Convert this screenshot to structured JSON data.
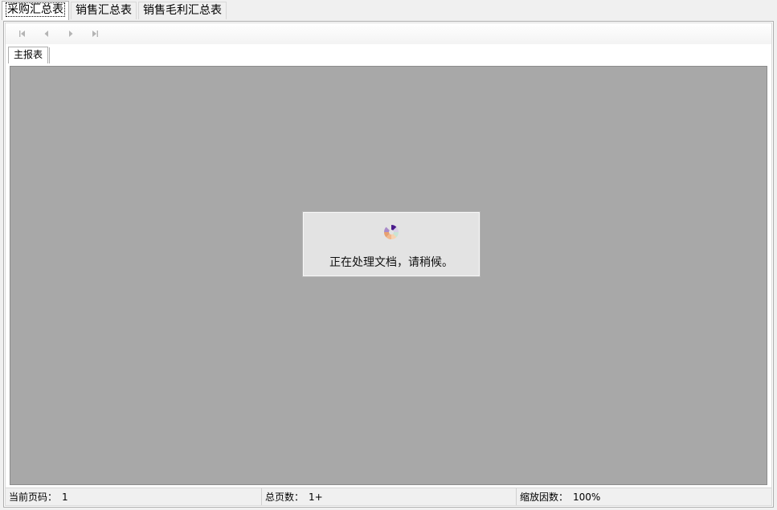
{
  "top_tabs": [
    {
      "label": "采购汇总表",
      "active": true
    },
    {
      "label": "销售汇总表",
      "active": false
    },
    {
      "label": "销售毛利汇总表",
      "active": false
    }
  ],
  "navigation": {
    "buttons": [
      "first-page-icon",
      "previous-page-icon",
      "next-page-icon",
      "last-page-icon"
    ]
  },
  "report_tabs": [
    {
      "label": "主报表",
      "active": true
    }
  ],
  "loading": {
    "message": "正在处理文档，请稍候。",
    "icon": "spinner-icon"
  },
  "status_bar": {
    "current_page_label": "当前页码：",
    "current_page_value": "1",
    "total_pages_label": "总页数：",
    "total_pages_value": "1+",
    "zoom_label": "缩放因数：",
    "zoom_value": "100%"
  },
  "colors": {
    "preview_background": "#a8a8a8",
    "loading_box": "#e3e3e3",
    "window_background": "#f0f0f0"
  }
}
